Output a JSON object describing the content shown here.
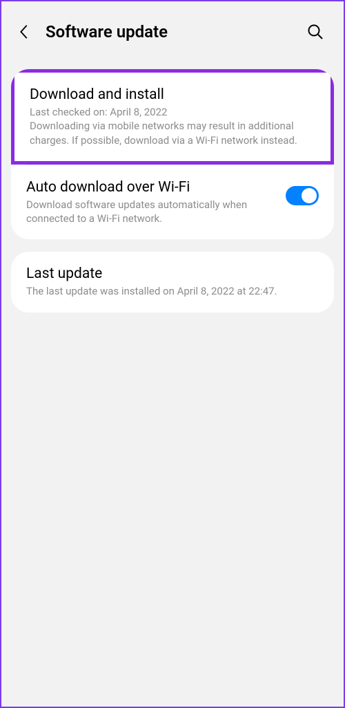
{
  "header": {
    "title": "Software update"
  },
  "card1": {
    "download": {
      "title": "Download and install",
      "subtitle": "Last checked on: April 8, 2022\nDownloading via mobile networks may result in additional charges. If possible, download via a Wi-Fi network instead."
    },
    "auto": {
      "title": "Auto download over Wi-Fi",
      "subtitle": "Download software updates automatically when connected to a Wi-Fi network."
    }
  },
  "card2": {
    "last": {
      "title": "Last update",
      "subtitle": "The last update was installed on April 8, 2022 at 22:47."
    }
  }
}
